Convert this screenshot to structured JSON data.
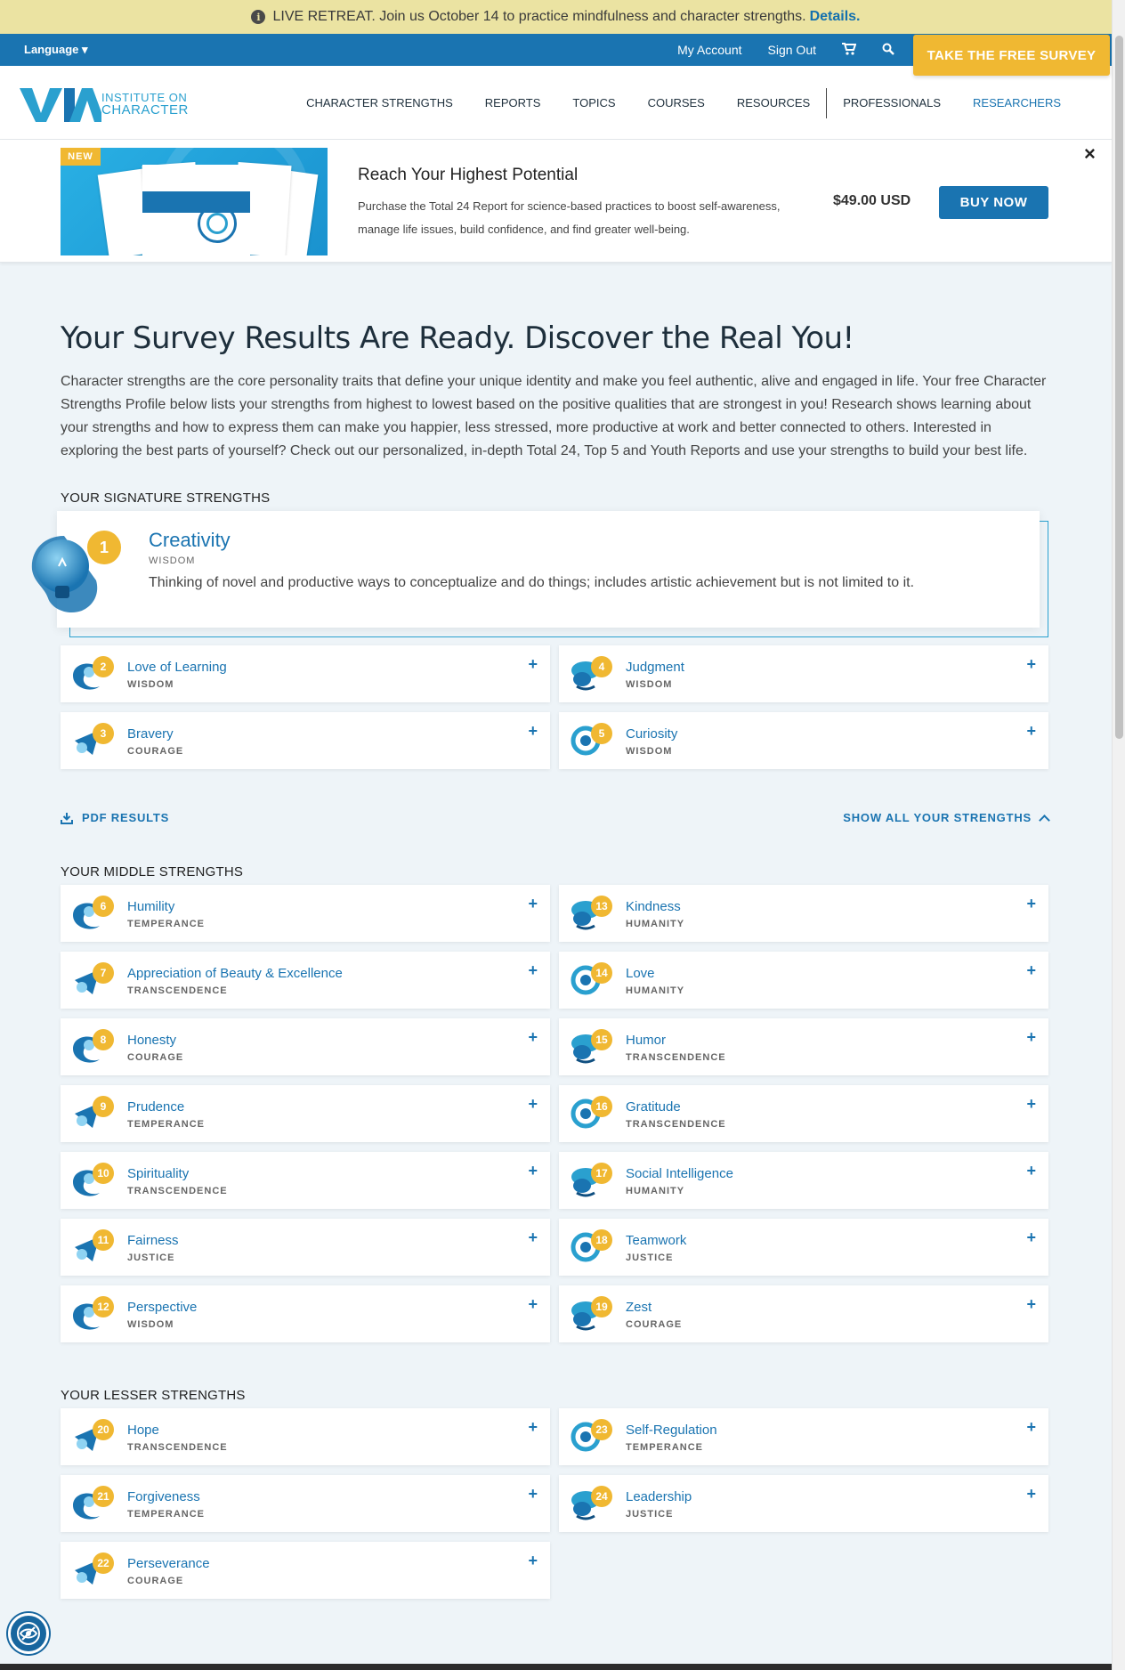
{
  "announcement": {
    "text": "LIVE RETREAT. Join us October 14 to practice mindfulness and character strengths.",
    "link": "Details."
  },
  "topbar": {
    "language": "Language ▾",
    "my_account": "My Account",
    "sign_out": "Sign Out",
    "survey_button": "TAKE THE FREE SURVEY"
  },
  "logo": {
    "mark": "VIA",
    "line1": "INSTITUTE ON",
    "line2": "CHARACTER"
  },
  "nav": {
    "items": [
      "CHARACTER STRENGTHS",
      "REPORTS",
      "TOPICS",
      "COURSES",
      "RESOURCES",
      "PROFESSIONALS",
      "RESEARCHERS"
    ]
  },
  "promo": {
    "badge": "NEW",
    "title": "Reach Your Highest Potential",
    "desc": "Purchase the Total 24 Report for science-based practices to boost self-awareness, manage life issues, build confidence, and find greater well-being.",
    "price": "$49.00 USD",
    "buy": "BUY NOW",
    "close": "×"
  },
  "main": {
    "title": "Your Survey Results Are Ready. Discover the Real You!",
    "intro": "Character strengths are the core personality traits that define your unique identity and make you feel authentic, alive and engaged in life. Your free Character Strengths Profile below lists your strengths from highest to lowest based on the positive qualities that are strongest in you! Research shows learning about your strengths and how to express them can make you happier, less stressed, more productive at work and better connected to others. Interested in exploring the best parts of yourself? Check out our personalized, in-depth Total 24, Top 5 and Youth Reports and use your strengths to build your best life."
  },
  "sections": {
    "signature": "YOUR SIGNATURE STRENGTHS",
    "middle": "YOUR MIDDLE STRENGTHS",
    "lesser": "YOUR LESSER STRENGTHS"
  },
  "top_strength": {
    "rank": "1",
    "name": "Creativity",
    "virtue": "WISDOM",
    "definition": "Thinking of novel and productive ways to conceptualize and do things; includes artistic achievement but is not limited to it."
  },
  "actions": {
    "pdf": "PDF RESULTS",
    "show_all": "SHOW ALL YOUR STRENGTHS"
  },
  "strengths": [
    {
      "rank": "2",
      "name": "Love of Learning",
      "virtue": "WISDOM"
    },
    {
      "rank": "4",
      "name": "Judgment",
      "virtue": "WISDOM"
    },
    {
      "rank": "3",
      "name": "Bravery",
      "virtue": "COURAGE"
    },
    {
      "rank": "5",
      "name": "Curiosity",
      "virtue": "WISDOM"
    },
    {
      "rank": "6",
      "name": "Humility",
      "virtue": "TEMPERANCE"
    },
    {
      "rank": "13",
      "name": "Kindness",
      "virtue": "HUMANITY"
    },
    {
      "rank": "7",
      "name": "Appreciation of Beauty & Excellence",
      "virtue": "TRANSCENDENCE"
    },
    {
      "rank": "14",
      "name": "Love",
      "virtue": "HUMANITY"
    },
    {
      "rank": "8",
      "name": "Honesty",
      "virtue": "COURAGE"
    },
    {
      "rank": "15",
      "name": "Humor",
      "virtue": "TRANSCENDENCE"
    },
    {
      "rank": "9",
      "name": "Prudence",
      "virtue": "TEMPERANCE"
    },
    {
      "rank": "16",
      "name": "Gratitude",
      "virtue": "TRANSCENDENCE"
    },
    {
      "rank": "10",
      "name": "Spirituality",
      "virtue": "TRANSCENDENCE"
    },
    {
      "rank": "17",
      "name": "Social Intelligence",
      "virtue": "HUMANITY"
    },
    {
      "rank": "11",
      "name": "Fairness",
      "virtue": "JUSTICE"
    },
    {
      "rank": "18",
      "name": "Teamwork",
      "virtue": "JUSTICE"
    },
    {
      "rank": "12",
      "name": "Perspective",
      "virtue": "WISDOM"
    },
    {
      "rank": "19",
      "name": "Zest",
      "virtue": "COURAGE"
    },
    {
      "rank": "20",
      "name": "Hope",
      "virtue": "TRANSCENDENCE"
    },
    {
      "rank": "23",
      "name": "Self-Regulation",
      "virtue": "TEMPERANCE"
    },
    {
      "rank": "21",
      "name": "Forgiveness",
      "virtue": "TEMPERANCE"
    },
    {
      "rank": "24",
      "name": "Leadership",
      "virtue": "JUSTICE"
    },
    {
      "rank": "22",
      "name": "Perseverance",
      "virtue": "COURAGE"
    }
  ],
  "colors": {
    "brand_blue": "#1a74b1",
    "accent_yellow": "#f0b832",
    "icon_light": "#2aa0cf"
  }
}
